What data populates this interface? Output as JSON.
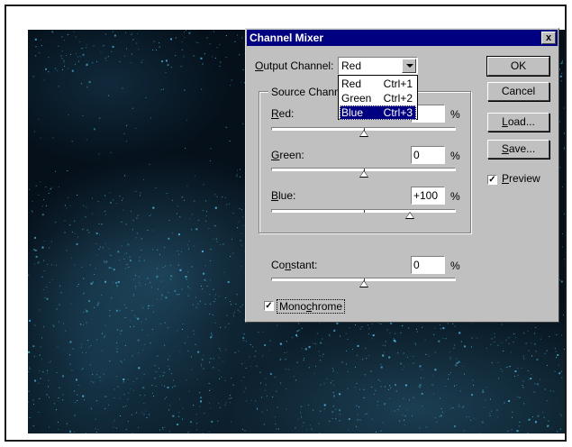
{
  "dialog": {
    "title": "Channel Mixer",
    "close_glyph": "x",
    "output_channel": {
      "label_pre": "",
      "label_u": "O",
      "label_post": "utput Channel:",
      "value": "Red",
      "options": [
        {
          "name": "Red",
          "shortcut": "Ctrl+1"
        },
        {
          "name": "Green",
          "shortcut": "Ctrl+2"
        },
        {
          "name": "Blue",
          "shortcut": "Ctrl+3"
        }
      ]
    },
    "source_channels": {
      "title": "Source Chann",
      "red": {
        "label_u": "R",
        "label_post": "ed:",
        "value": "",
        "unit": "%",
        "slider_fraction": 0.5
      },
      "green": {
        "label_u": "G",
        "label_post": "reen:",
        "value": "0",
        "unit": "%",
        "slider_fraction": 0.5
      },
      "blue": {
        "label_u": "B",
        "label_post": "lue:",
        "value": "+100",
        "unit": "%",
        "slider_fraction": 0.75
      }
    },
    "constant": {
      "label_pre": "Co",
      "label_u": "n",
      "label_post": "stant:",
      "value": "0",
      "unit": "%",
      "slider_fraction": 0.5
    },
    "monochrome": {
      "label_pre": "Mono",
      "label_u": "c",
      "label_post": "hrome",
      "checked": true,
      "check_glyph": "✓"
    },
    "buttons": {
      "ok": "OK",
      "cancel": "Cancel",
      "load_u": "L",
      "load_post": "oad...",
      "save_u": "S",
      "save_post": "ave..."
    },
    "preview": {
      "label_u": "P",
      "label_post": "review",
      "checked": true,
      "check_glyph": "✓"
    }
  },
  "colors": {
    "titlebar": "#000080",
    "dialog_bg": "#c0c0c0",
    "photo_speckle": "#4fb8e0"
  }
}
